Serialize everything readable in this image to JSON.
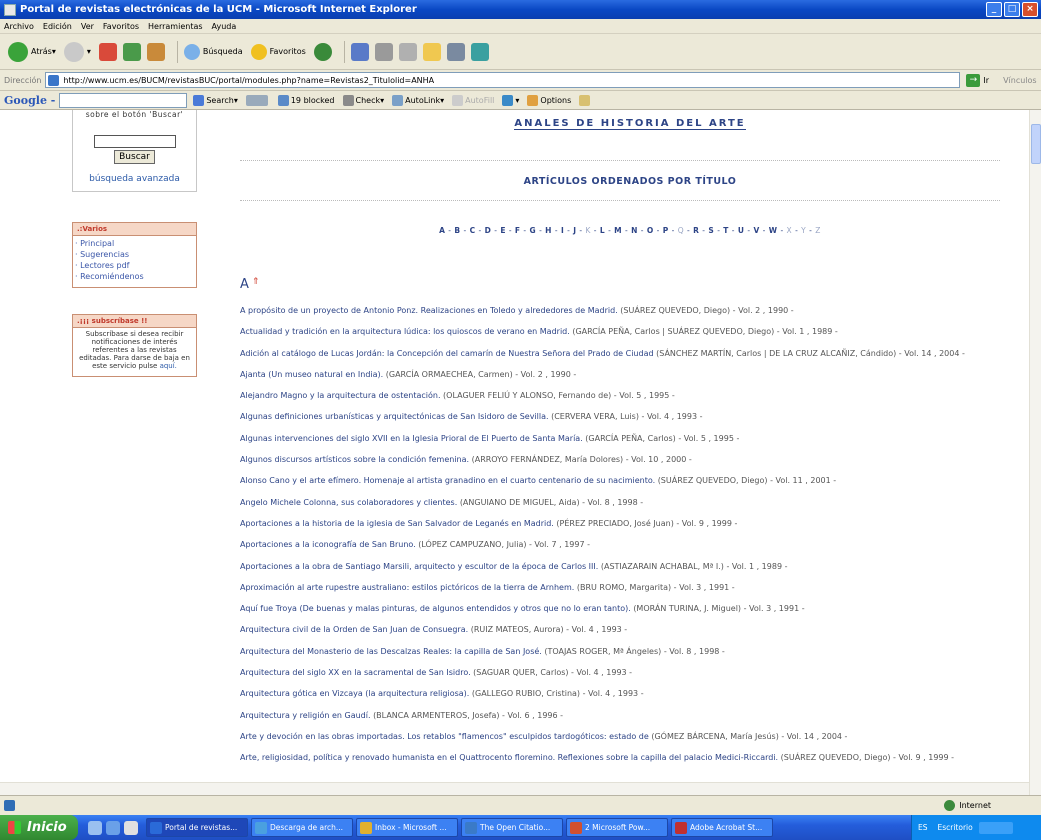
{
  "window": {
    "title": "Portal de revistas electrónicas de la UCM - Microsoft Internet Explorer"
  },
  "menubar": [
    "Archivo",
    "Edición",
    "Ver",
    "Favoritos",
    "Herramientas",
    "Ayuda"
  ],
  "toolbar": {
    "back": "Atrás",
    "search": "Búsqueda",
    "favorites": "Favoritos"
  },
  "address": {
    "label": "Dirección",
    "url": "http://www.ucm.es/BUCM/revistasBUC/portal/modules.php?name=Revistas2_Titulolid=ANHA",
    "go": "Ir",
    "links": "Vínculos"
  },
  "googlebar": {
    "logo": "Google -",
    "search_btn": "Search",
    "blocked": "19 blocked",
    "check": "Check",
    "autolink": "AutoLink",
    "autofill": "AutoFill",
    "options": "Options"
  },
  "sidebar": {
    "search_hint": "sobre el botón 'Buscar'",
    "search_button": "Buscar",
    "advanced": "búsqueda avanzada",
    "varios_header": ".:Varios",
    "varios_items": [
      "· Principal",
      "· Sugerencias",
      "· Lectores pdf",
      "· Recomiéndenos"
    ],
    "subscribe_header": ".¡¡¡ subscríbase !!",
    "subscribe_text": "Subscríbase si desea recibir notificaciones de interés referentes a las revistas editadas. Para darse de baja en este servicio pulse",
    "subscribe_link": "aquí."
  },
  "main": {
    "journal_title": "ANALES DE HISTORIA DEL ARTE",
    "section_title": "ARTÍCULOS ORDENADOS POR TÍTULO",
    "alphabet": [
      {
        "l": "A",
        "a": true
      },
      {
        "l": "B",
        "a": true
      },
      {
        "l": "C",
        "a": true
      },
      {
        "l": "D",
        "a": true
      },
      {
        "l": "E",
        "a": true
      },
      {
        "l": "F",
        "a": true
      },
      {
        "l": "G",
        "a": true
      },
      {
        "l": "H",
        "a": true
      },
      {
        "l": "I",
        "a": true
      },
      {
        "l": "J",
        "a": true
      },
      {
        "l": "K",
        "a": false
      },
      {
        "l": "L",
        "a": true
      },
      {
        "l": "M",
        "a": true
      },
      {
        "l": "N",
        "a": true
      },
      {
        "l": "O",
        "a": true
      },
      {
        "l": "P",
        "a": true
      },
      {
        "l": "Q",
        "a": false
      },
      {
        "l": "R",
        "a": true
      },
      {
        "l": "S",
        "a": true
      },
      {
        "l": "T",
        "a": true
      },
      {
        "l": "U",
        "a": true
      },
      {
        "l": "V",
        "a": true
      },
      {
        "l": "W",
        "a": true
      },
      {
        "l": "X",
        "a": false
      },
      {
        "l": "Y",
        "a": false
      },
      {
        "l": "Z",
        "a": false
      }
    ],
    "current_letter": "A",
    "up_arrow": "⇑",
    "articles": [
      {
        "t": "A propósito de un proyecto de Antonio Ponz. Realizaciones en Toledo y alrededores de Madrid.",
        "m": "(SUÁREZ QUEVEDO, Diego) - Vol. 2 , 1990 -"
      },
      {
        "t": "Actualidad y tradición en la arquitectura lúdica: los quioscos de verano en Madrid.",
        "m": "(GARCÍA PEÑA, Carlos | SUÁREZ QUEVEDO, Diego) - Vol. 1 , 1989 -"
      },
      {
        "t": "Adición al catálogo de Lucas Jordán: la Concepción del camarín de Nuestra Señora del Prado de Ciudad",
        "m": "(SÁNCHEZ MARTÍN, Carlos | DE LA CRUZ ALCAÑIZ, Cándido) - Vol. 14 , 2004 -"
      },
      {
        "t": "Ajanta (Un museo natural en India).",
        "m": "(GARCÍA ORMAECHEA, Carmen) - Vol. 2 , 1990 -"
      },
      {
        "t": "Alejandro Magno y la arquitectura de ostentación.",
        "m": "(OLAGUER FELIÚ Y ALONSO, Fernando de) - Vol. 5 , 1995 -"
      },
      {
        "t": "Algunas definiciones urbanísticas y arquitectónicas de San Isidoro de Sevilla.",
        "m": "(CERVERA VERA, Luis) - Vol. 4 , 1993 -"
      },
      {
        "t": "Algunas intervenciones del siglo XVII en la Iglesia Prioral de El Puerto de Santa María.",
        "m": "(GARCÍA PEÑA, Carlos) - Vol. 5 , 1995 -"
      },
      {
        "t": "Algunos discursos artísticos sobre la condición femenina.",
        "m": "(ARROYO FERNÁNDEZ, María Dolores) - Vol. 10 , 2000 -"
      },
      {
        "t": "Alonso Cano y el arte efímero. Homenaje al artista granadino en el cuarto centenario de su nacimiento.",
        "m": "(SUÁREZ QUEVEDO, Diego) - Vol. 11 , 2001 -"
      },
      {
        "t": "Angelo Michele Colonna, sus colaboradores y clientes.",
        "m": "(ANGUIANO DE MIGUEL, Aida) - Vol. 8 , 1998 -"
      },
      {
        "t": "Aportaciones a la historia de la iglesia de San Salvador de Leganés en Madrid.",
        "m": "(PÉREZ PRECIADO, José Juan) - Vol. 9 , 1999 -"
      },
      {
        "t": "Aportaciones a la iconografía de San Bruno.",
        "m": "(LÓPEZ CAMPUZANO, Julia) - Vol. 7 , 1997 -"
      },
      {
        "t": "Aportaciones a la obra de Santiago Marsili, arquitecto y escultor de la época de Carlos III.",
        "m": "(ASTIAZARAIN ACHABAL, Mª I.) - Vol. 1 , 1989 -"
      },
      {
        "t": "Aproximación al arte rupestre australiano: estilos pictóricos de la tierra de Arnhem.",
        "m": "(BRU ROMO, Margarita) - Vol. 3 , 1991 -"
      },
      {
        "t": "Aquí fue Troya (De buenas y malas pinturas, de algunos entendidos y otros que no lo eran tanto).",
        "m": "(MORÁN TURINA, J. Miguel) - Vol. 3 , 1991 -"
      },
      {
        "t": "Arquitectura civil de la Orden de San Juan de Consuegra.",
        "m": "(RUIZ MATEOS, Aurora) - Vol. 4 , 1993 -"
      },
      {
        "t": "Arquitectura del Monasterio de las Descalzas Reales: la capilla de San José.",
        "m": "(TOAJAS ROGER, Mª Ángeles) - Vol. 8 , 1998 -"
      },
      {
        "t": "Arquitectura del siglo XX en la sacramental de San Isidro.",
        "m": "(SAGUAR QUER, Carlos) - Vol. 4 , 1993 -"
      },
      {
        "t": "Arquitectura gótica en Vizcaya (la arquitectura religiosa).",
        "m": "(GALLEGO RUBIO, Cristina) - Vol. 4 , 1993 -"
      },
      {
        "t": "Arquitectura y religión en Gaudí.",
        "m": "(BLANCA ARMENTEROS, Josefa) - Vol. 6 , 1996 -"
      },
      {
        "t": "Arte y devoción en las obras importadas. Los retablos \"flamencos\" esculpidos tardogóticos: estado de",
        "m": "(GÓMEZ BÁRCENA, María Jesús) - Vol. 14 , 2004 -"
      },
      {
        "t": "Arte, religiosidad, política y renovado humanista en el Quattrocento floremino. Reflexiones sobre la capilla del palacio Medici-Riccardi.",
        "m": "(SUÁREZ QUEVEDO, Diego) - Vol. 9 , 1999 -"
      }
    ]
  },
  "status": {
    "zone": "Internet"
  },
  "taskbar": {
    "start": "Inicio",
    "tasks": [
      "Portal de revistas...",
      "Descarga de arch...",
      "Inbox - Microsoft ...",
      "The Open Citatio...",
      "2 Microsoft Pow...",
      "Adobe Acrobat St..."
    ],
    "lang": "ES",
    "desktop": "Escritorio"
  }
}
